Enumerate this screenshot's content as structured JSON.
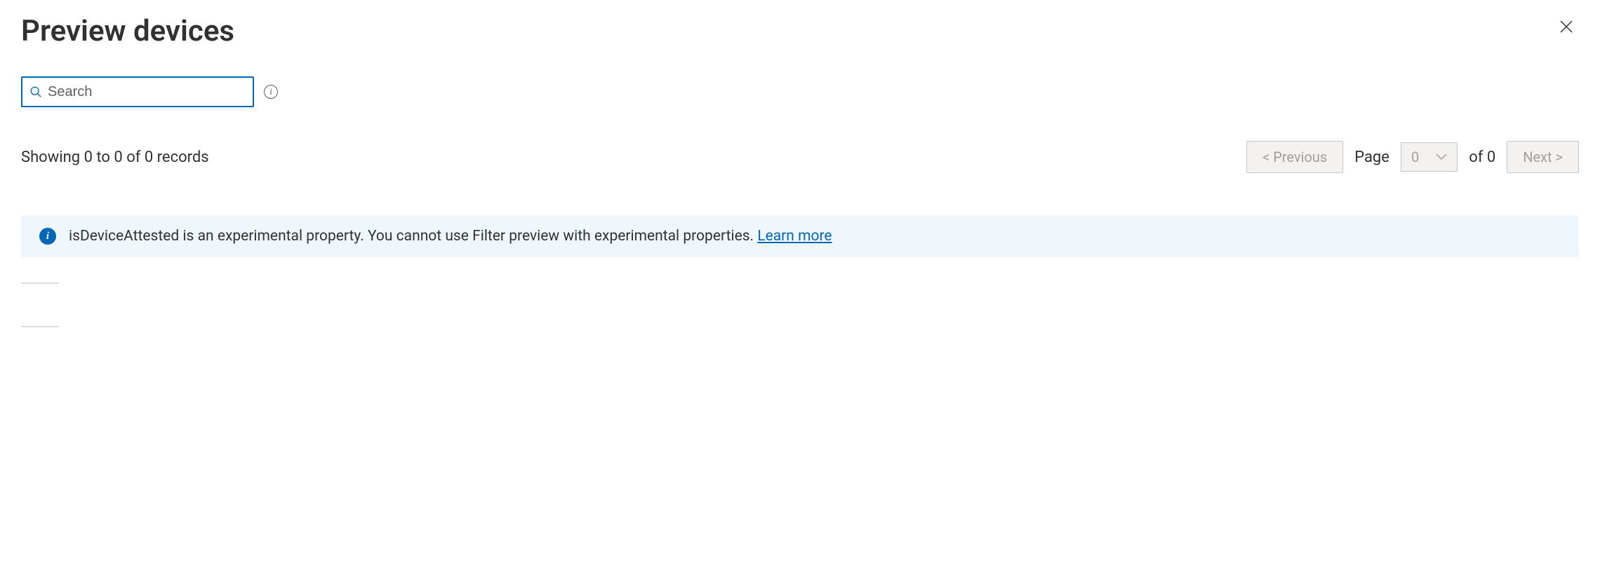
{
  "header": {
    "title": "Preview devices"
  },
  "search": {
    "placeholder": "Search"
  },
  "results": {
    "summary": "Showing 0 to 0 of 0 records"
  },
  "pagination": {
    "prev_label": "<  Previous",
    "next_label": "Next  >",
    "page_label": "Page",
    "page_value": "0",
    "of_label": "of 0"
  },
  "banner": {
    "message": "isDeviceAttested is an experimental property. You cannot use Filter preview with experimental properties. ",
    "link_label": "Learn more"
  }
}
